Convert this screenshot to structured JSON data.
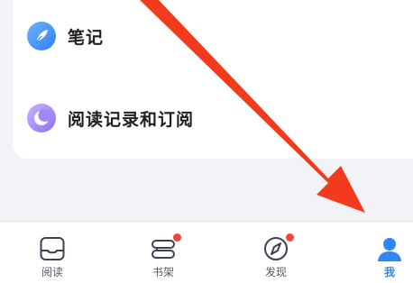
{
  "menu": {
    "notes_label": "笔记",
    "history_label": "阅读记录和订阅"
  },
  "tabbar": {
    "tabs": [
      {
        "label": "阅读",
        "icon": "reading-tab-icon",
        "active": false,
        "badge": false
      },
      {
        "label": "书架",
        "icon": "bookshelf-icon",
        "active": false,
        "badge": true
      },
      {
        "label": "发现",
        "icon": "compass-icon",
        "active": false,
        "badge": true
      },
      {
        "label": "我",
        "icon": "person-icon",
        "active": true,
        "badge": false
      }
    ]
  },
  "colors": {
    "accent": "#2f86f6",
    "badge": "#f2463b",
    "arrow": "#f23a1d"
  }
}
